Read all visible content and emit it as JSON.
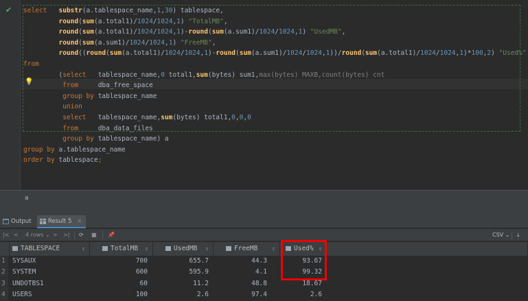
{
  "editor": {
    "lines": [
      [
        {
          "t": "select",
          "c": "kw"
        },
        {
          "t": "   ",
          "c": "plain"
        },
        {
          "t": "substr",
          "c": "fn bold"
        },
        {
          "t": "(a.tablespace_name,",
          "c": "plain"
        },
        {
          "t": "1",
          "c": "num"
        },
        {
          "t": ",",
          "c": "plain"
        },
        {
          "t": "30",
          "c": "num"
        },
        {
          "t": ") tablespace,",
          "c": "plain"
        }
      ],
      [
        {
          "t": "         ",
          "c": "plain"
        },
        {
          "t": "round",
          "c": "fn bold"
        },
        {
          "t": "(",
          "c": "plain"
        },
        {
          "t": "sum",
          "c": "fn bold"
        },
        {
          "t": "(a.total1)/",
          "c": "plain"
        },
        {
          "t": "1024",
          "c": "num"
        },
        {
          "t": "/",
          "c": "plain"
        },
        {
          "t": "1024",
          "c": "num"
        },
        {
          "t": ",",
          "c": "plain"
        },
        {
          "t": "1",
          "c": "num"
        },
        {
          "t": ") ",
          "c": "plain"
        },
        {
          "t": "\"TotalMB\"",
          "c": "str"
        },
        {
          "t": ",",
          "c": "plain"
        }
      ],
      [
        {
          "t": "         ",
          "c": "plain"
        },
        {
          "t": "round",
          "c": "fn bold"
        },
        {
          "t": "(",
          "c": "plain"
        },
        {
          "t": "sum",
          "c": "fn bold"
        },
        {
          "t": "(a.total1)/",
          "c": "plain"
        },
        {
          "t": "1024",
          "c": "num"
        },
        {
          "t": "/",
          "c": "plain"
        },
        {
          "t": "1024",
          "c": "num"
        },
        {
          "t": ",",
          "c": "plain"
        },
        {
          "t": "1",
          "c": "num"
        },
        {
          "t": ")-",
          "c": "plain"
        },
        {
          "t": "round",
          "c": "fn bold"
        },
        {
          "t": "(",
          "c": "plain"
        },
        {
          "t": "sum",
          "c": "fn bold"
        },
        {
          "t": "(a.sum1)/",
          "c": "plain"
        },
        {
          "t": "1024",
          "c": "num"
        },
        {
          "t": "/",
          "c": "plain"
        },
        {
          "t": "1024",
          "c": "num"
        },
        {
          "t": ",",
          "c": "plain"
        },
        {
          "t": "1",
          "c": "num"
        },
        {
          "t": ") ",
          "c": "plain"
        },
        {
          "t": "\"UsedMB\"",
          "c": "str"
        },
        {
          "t": ",",
          "c": "plain"
        }
      ],
      [
        {
          "t": "         ",
          "c": "plain"
        },
        {
          "t": "round",
          "c": "fn bold"
        },
        {
          "t": "(",
          "c": "plain"
        },
        {
          "t": "sum",
          "c": "fn bold"
        },
        {
          "t": "(a.sum1)/",
          "c": "plain"
        },
        {
          "t": "1024",
          "c": "num"
        },
        {
          "t": "/",
          "c": "plain"
        },
        {
          "t": "1024",
          "c": "num"
        },
        {
          "t": ",",
          "c": "plain"
        },
        {
          "t": "1",
          "c": "num"
        },
        {
          "t": ") ",
          "c": "plain"
        },
        {
          "t": "\"FreeMB\"",
          "c": "str"
        },
        {
          "t": ",",
          "c": "plain"
        }
      ],
      [
        {
          "t": "         ",
          "c": "plain"
        },
        {
          "t": "round",
          "c": "fn bold"
        },
        {
          "t": "((",
          "c": "plain"
        },
        {
          "t": "round",
          "c": "fn bold"
        },
        {
          "t": "(",
          "c": "plain"
        },
        {
          "t": "sum",
          "c": "fn bold"
        },
        {
          "t": "(a.total1)/",
          "c": "plain"
        },
        {
          "t": "1024",
          "c": "num"
        },
        {
          "t": "/",
          "c": "plain"
        },
        {
          "t": "1024",
          "c": "num"
        },
        {
          "t": ",",
          "c": "plain"
        },
        {
          "t": "1",
          "c": "num"
        },
        {
          "t": ")-",
          "c": "plain"
        },
        {
          "t": "round",
          "c": "fn bold"
        },
        {
          "t": "(",
          "c": "plain"
        },
        {
          "t": "sum",
          "c": "fn bold"
        },
        {
          "t": "(a.sum1)/",
          "c": "plain"
        },
        {
          "t": "1024",
          "c": "num"
        },
        {
          "t": "/",
          "c": "plain"
        },
        {
          "t": "1024",
          "c": "num"
        },
        {
          "t": ",",
          "c": "plain"
        },
        {
          "t": "1",
          "c": "num"
        },
        {
          "t": "))/",
          "c": "plain"
        },
        {
          "t": "round",
          "c": "fn bold"
        },
        {
          "t": "(",
          "c": "plain"
        },
        {
          "t": "sum",
          "c": "fn bold"
        },
        {
          "t": "(a.total1)/",
          "c": "plain"
        },
        {
          "t": "1024",
          "c": "num"
        },
        {
          "t": "/",
          "c": "plain"
        },
        {
          "t": "1024",
          "c": "num"
        },
        {
          "t": ",",
          "c": "plain"
        },
        {
          "t": "1",
          "c": "num"
        },
        {
          "t": ")*",
          "c": "plain"
        },
        {
          "t": "100",
          "c": "num"
        },
        {
          "t": ",",
          "c": "plain"
        },
        {
          "t": "2",
          "c": "num"
        },
        {
          "t": ") ",
          "c": "plain"
        },
        {
          "t": "\"Used%\"",
          "c": "str"
        }
      ],
      [
        {
          "t": "from",
          "c": "kw"
        }
      ],
      [
        {
          "t": "         (",
          "c": "plain"
        },
        {
          "t": "select",
          "c": "kw"
        },
        {
          "t": "   tablespace_name,",
          "c": "plain"
        },
        {
          "t": "0",
          "c": "num"
        },
        {
          "t": " total1,",
          "c": "plain"
        },
        {
          "t": "sum",
          "c": "fn bold"
        },
        {
          "t": "(bytes) sum1,",
          "c": "plain"
        },
        {
          "t": "max",
          "c": "gray"
        },
        {
          "t": "(bytes) ",
          "c": "gray"
        },
        {
          "t": "MAXB,",
          "c": "gray"
        },
        {
          "t": "count",
          "c": "gray"
        },
        {
          "t": "(bytes) cnt",
          "c": "gray"
        }
      ],
      [
        {
          "t": "          ",
          "c": "plain"
        },
        {
          "t": "from",
          "c": "kw"
        },
        {
          "t": "     dba_free_space",
          "c": "plain"
        }
      ],
      [
        {
          "t": "          ",
          "c": "plain"
        },
        {
          "t": "group by",
          "c": "kw"
        },
        {
          "t": " tablespace_name",
          "c": "plain"
        }
      ],
      [
        {
          "t": "          ",
          "c": "plain"
        },
        {
          "t": "union",
          "c": "kw"
        }
      ],
      [
        {
          "t": "          ",
          "c": "plain"
        },
        {
          "t": "select",
          "c": "kw"
        },
        {
          "t": "   tablespace_name,",
          "c": "plain"
        },
        {
          "t": "sum",
          "c": "fn bold"
        },
        {
          "t": "(bytes) total1,",
          "c": "plain"
        },
        {
          "t": "0",
          "c": "num"
        },
        {
          "t": ",",
          "c": "plain"
        },
        {
          "t": "0",
          "c": "num"
        },
        {
          "t": ",",
          "c": "plain"
        },
        {
          "t": "0",
          "c": "num"
        }
      ],
      [
        {
          "t": "          ",
          "c": "plain"
        },
        {
          "t": "from",
          "c": "kw"
        },
        {
          "t": "     dba_data_files",
          "c": "plain"
        }
      ],
      [
        {
          "t": "          ",
          "c": "plain"
        },
        {
          "t": "group by",
          "c": "kw"
        },
        {
          "t": " tablespace_name) a",
          "c": "plain"
        }
      ],
      [
        {
          "t": "group by",
          "c": "kw"
        },
        {
          "t": " a.tablespace_name",
          "c": "plain"
        }
      ],
      [
        {
          "t": "order by",
          "c": "kw"
        },
        {
          "t": " tablespace",
          "c": "plain"
        },
        {
          "t": ";",
          "c": "kw"
        }
      ]
    ]
  },
  "status": {
    "alias": "a"
  },
  "tabs": {
    "output": "Output",
    "result": "Result 5"
  },
  "toolbar": {
    "rows": "4 rows",
    "csv": "CSV"
  },
  "grid": {
    "columns": [
      "TABLESPACE",
      "TotalMB",
      "UsedMB",
      "FreeMB",
      "Used%"
    ],
    "rows": [
      {
        "n": "1",
        "tablespace": "SYSAUX",
        "total": "700",
        "used": "655.7",
        "free": "44.3",
        "pct": "93.67"
      },
      {
        "n": "2",
        "tablespace": "SYSTEM",
        "total": "600",
        "used": "595.9",
        "free": "4.1",
        "pct": "99.32"
      },
      {
        "n": "3",
        "tablespace": "UNDOTBS1",
        "total": "60",
        "used": "11.2",
        "free": "48.8",
        "pct": "18.67"
      },
      {
        "n": "4",
        "tablespace": "USERS",
        "total": "100",
        "used": "2.6",
        "free": "97.4",
        "pct": "2.6"
      }
    ]
  },
  "colors": {
    "highlight": "#e00000",
    "keyword": "#cc7832",
    "function": "#ffc66d",
    "number": "#6897bb",
    "string": "#6a8759"
  }
}
